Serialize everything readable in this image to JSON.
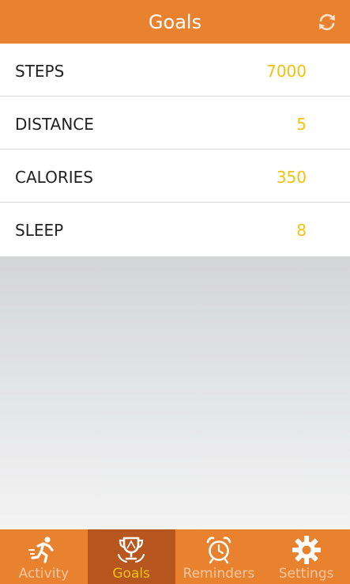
{
  "header": {
    "title": "Goals",
    "refresh_icon": "refresh-icon"
  },
  "goals": [
    {
      "label": "STEPS",
      "value": "7000"
    },
    {
      "label": "DISTANCE",
      "value": "5"
    },
    {
      "label": "CALORIES",
      "value": "350"
    },
    {
      "label": "SLEEP",
      "value": "8"
    }
  ],
  "nav": {
    "items": [
      {
        "label": "Activity",
        "icon": "running-person-icon",
        "active": false
      },
      {
        "label": "Goals",
        "icon": "trophy-icon",
        "active": true
      },
      {
        "label": "Reminders",
        "icon": "alarm-clock-icon",
        "active": false
      },
      {
        "label": "Settings",
        "icon": "gear-icon",
        "active": false
      }
    ]
  },
  "colors": {
    "accent": "#e8822e",
    "nav_active": "#b7561f",
    "value_text": "#f4c20d"
  }
}
